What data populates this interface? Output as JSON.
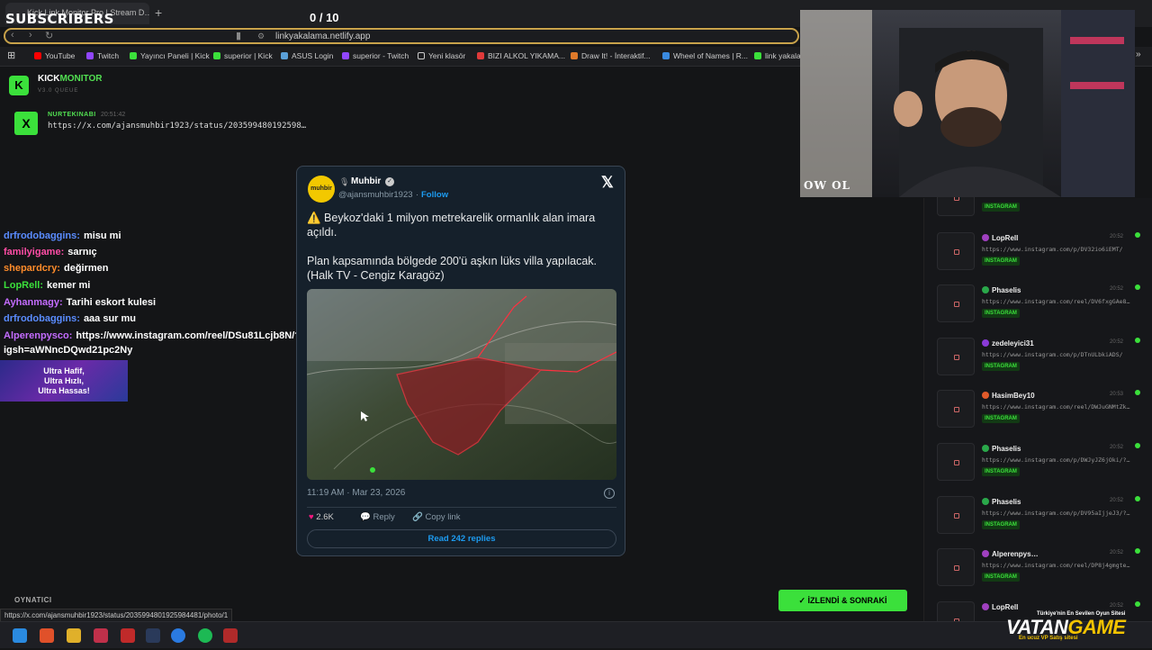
{
  "browser": {
    "tab_title": "Kick Link Monitor Pro | Stream D…",
    "url": "linkyakalama.netlify.app",
    "bookmarks": [
      "YouTube",
      "Twitch",
      "Yayıncı Paneli | Kick",
      "superior | Kick",
      "ASUS Login",
      "superior - Twitch",
      "Yeni klasör",
      "BIZI ALKOL YIKAMA...",
      "Draw It! - İnteraktif...",
      "Wheel of Names | R...",
      "link yakala"
    ]
  },
  "overlay": {
    "subs_label": "SUBSCRIBERS",
    "subs_count": "0 / 10",
    "cam_logo": "OW OL"
  },
  "app": {
    "name_left": "KICK",
    "name_right": "MONITOR",
    "version": "V3.0 QUEUE"
  },
  "queue_current": {
    "user": "NURTEKINABI",
    "time": "20:51:42",
    "url": "https://x.com/ajansmuhbir1923/status/203599480192598…"
  },
  "chat": [
    {
      "user": "drfrodobaggins:",
      "msg": "misu mi",
      "color": "#5a8cff"
    },
    {
      "user": "familyigame:",
      "msg": "sarnıç",
      "color": "#ff4da6"
    },
    {
      "user": "shepardcry:",
      "msg": "değirmen",
      "color": "#ff8c2a"
    },
    {
      "user": "LopRell:",
      "msg": "kemer mi",
      "color": "#3be03b"
    },
    {
      "user": "Ayhanmagy:",
      "msg": "Tarihi eskort kulesi",
      "color": "#c46cff"
    },
    {
      "user": "drfrodobaggins:",
      "msg": "aaa sur mu",
      "color": "#5a8cff"
    },
    {
      "user": "Alperenpysco:",
      "msg": "https://www.instagram.com/reel/DSu81Lcjb8N/?",
      "color": "#c46cff"
    },
    {
      "user": "",
      "msg": "igsh=aWNncDQwd21pc2Ny",
      "color": "#fff"
    }
  ],
  "ad_text": [
    "Ultra Hafif,",
    "Ultra Hızlı,",
    "Ultra Hassas!"
  ],
  "tweet": {
    "name": "Muhbir",
    "handle": "@ajansmuhbir1923",
    "follow": "Follow",
    "avatar_text": "muhbir",
    "text1": "⚠️ Beykoz'daki 1 milyon metrekarelik ormanlık alan imara açıldı.",
    "text2": "Plan kapsamında bölgede 200'ü aşkın lüks villa yapılacak. (Halk TV - Cengiz Karagöz)",
    "date": "11:19 AM · Mar 23, 2026",
    "likes": "2.6K",
    "reply": "Reply",
    "copy": "Copy link",
    "read_replies": "Read 242 replies"
  },
  "right_list": [
    {
      "name": "",
      "url": "",
      "tag": "INSTAGRAM",
      "time": "",
      "color": "#999"
    },
    {
      "name": "LopRell",
      "url": "https://www.instagram.com/p/DV32io6iEMT/",
      "tag": "INSTAGRAM",
      "time": "20:52",
      "color": "#a040c0"
    },
    {
      "name": "Phaselis",
      "url": "https://www.instagram.com/reel/DV6fxgGAe8…",
      "tag": "INSTAGRAM",
      "time": "20:52",
      "color": "#2aa84a"
    },
    {
      "name": "zedeleyici31",
      "url": "https://www.instagram.com/p/DTnULbkiADS/",
      "tag": "INSTAGRAM",
      "time": "20:52",
      "color": "#8a3ad8"
    },
    {
      "name": "HasimBey10",
      "url": "https://www.instagram.com/reel/DWJuGNMtZk…",
      "tag": "INSTAGRAM",
      "time": "20:53",
      "color": "#e05a2a"
    },
    {
      "name": "Phaselis",
      "url": "https://www.instagram.com/p/DWJyJZ6jOki/?…",
      "tag": "INSTAGRAM",
      "time": "20:52",
      "color": "#2aa84a"
    },
    {
      "name": "Phaselis",
      "url": "https://www.instagram.com/p/DV95aIjjeJ3/?…",
      "tag": "INSTAGRAM",
      "time": "20:52",
      "color": "#2aa84a"
    },
    {
      "name": "Alperenpys…",
      "url": "https://www.instagram.com/reel/DP8j4gmgte…",
      "tag": "INSTAGRAM",
      "time": "20:52",
      "color": "#a040c0"
    },
    {
      "name": "LopRell",
      "url": "",
      "tag": "",
      "time": "20:52",
      "color": "#a040c0"
    }
  ],
  "footer": {
    "player_label": "OYNATICI",
    "status_url": "https://x.com/ajansmuhbir1923/status/2035994801925984481/photo/1",
    "next_button": "İZLENDİ & SONRAKİ",
    "vg_left": "VATAN",
    "vg_right": "GAME",
    "vg_tag1": "Türkiye'nin En Sevilen Oyun Sitesi",
    "vg_tag2": "En ucuz VP Satış sitesi"
  }
}
